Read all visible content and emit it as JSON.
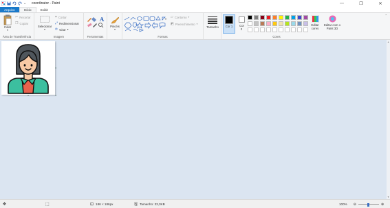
{
  "window": {
    "title": "coordinator - Paint",
    "controls": [
      "—",
      "❐",
      "✕"
    ]
  },
  "tabs": [
    "Arquivo",
    "Início",
    "Exibir"
  ],
  "ribbon": {
    "clipboard": {
      "paste": "Colar",
      "cut": "Recortar",
      "copy": "Copiar",
      "label": "Área de Transferência"
    },
    "image": {
      "select": "Selecionar",
      "crop": "Cortar",
      "resize": "Redimensionar",
      "rotate": "Girar",
      "label": "Imagem"
    },
    "tools": {
      "label": "Ferramentas"
    },
    "brushes": {
      "label": "Pincéis"
    },
    "shapes": {
      "outline": "Contorno",
      "fill": "Preenchimento",
      "label": "Formas"
    },
    "size": {
      "label": "Tamanho"
    },
    "colors": {
      "color1": "Cor 1",
      "color2": "Cor 2",
      "edit_colors": "Editar cores",
      "edit_paint3d": "Editar com o Paint 3D",
      "label": "Cores",
      "palette_row1": [
        "#000000",
        "#7f7f7f",
        "#880015",
        "#ed1c24",
        "#ff7f27",
        "#fff200",
        "#22b14c",
        "#00a2e8",
        "#3f48cc",
        "#a349a4"
      ],
      "palette_row2": [
        "#ffffff",
        "#c3c3c3",
        "#b97a57",
        "#ffaec9",
        "#ffc90e",
        "#efe4b0",
        "#b5e61d",
        "#99d9ea",
        "#7092be",
        "#c8bfe7"
      ]
    }
  },
  "status": {
    "dimensions": "186 × 186px",
    "size": "Tamanho: 33,3KB",
    "zoom": "100%"
  }
}
